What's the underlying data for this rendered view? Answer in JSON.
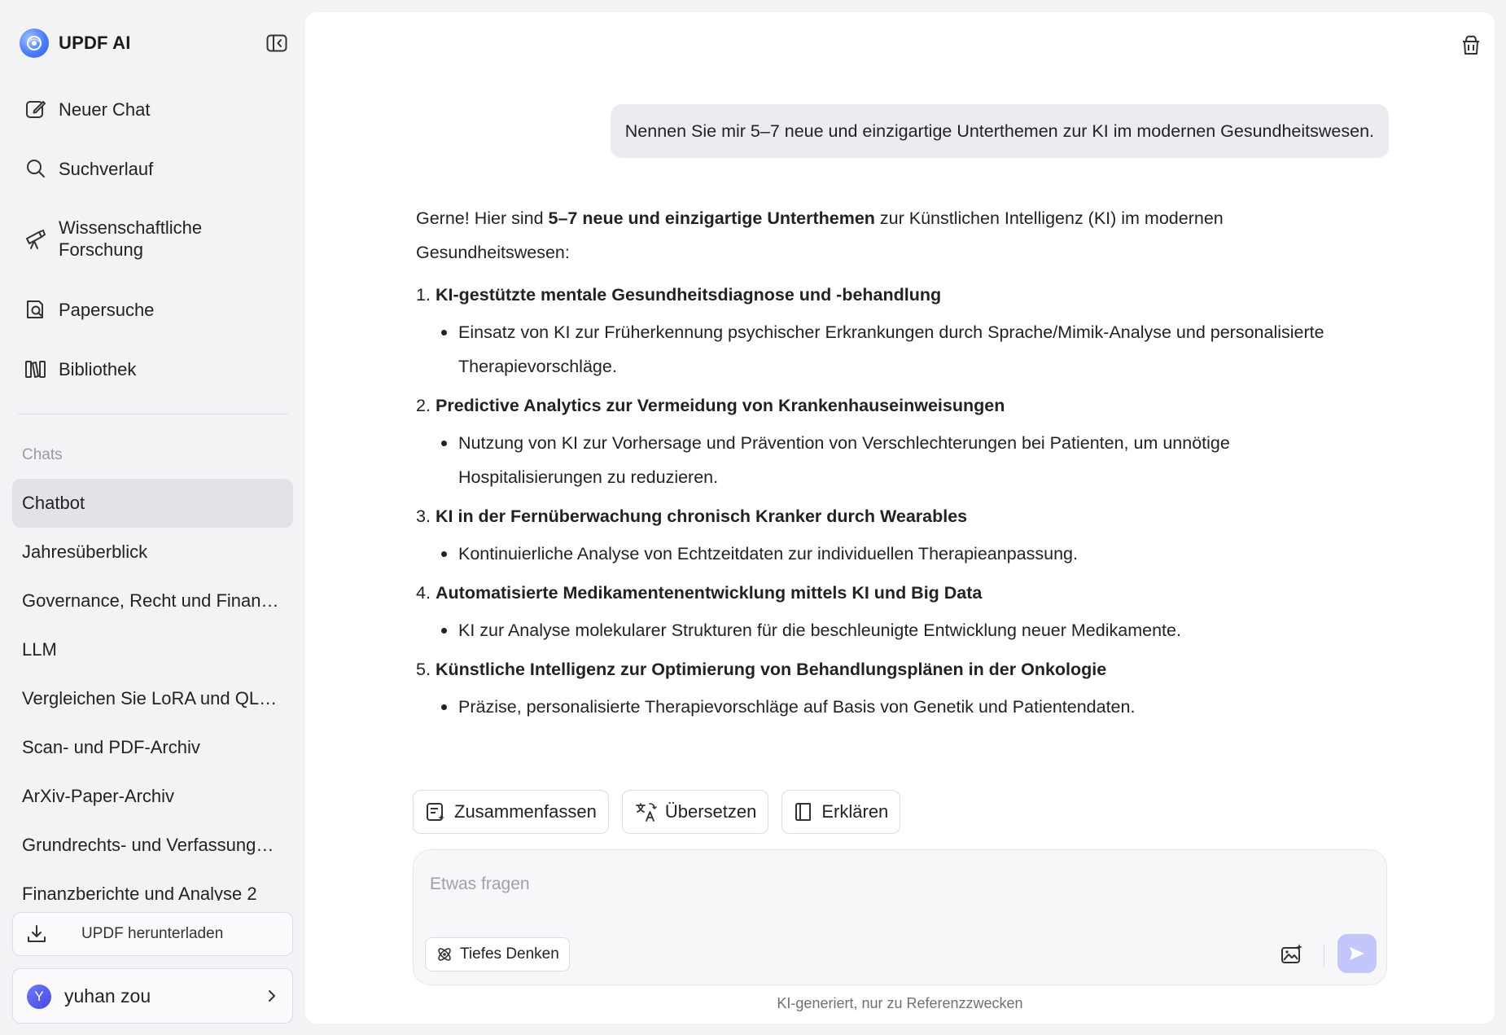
{
  "brand": {
    "name": "UPDF AI"
  },
  "nav": [
    {
      "label": "Neuer Chat",
      "icon": "edit-icon"
    },
    {
      "label": "Suchverlauf",
      "icon": "search-icon"
    },
    {
      "label": "Wissenschaftliche Forschung",
      "icon": "telescope-icon"
    },
    {
      "label": "Papersuche",
      "icon": "document-search-icon"
    },
    {
      "label": "Bibliothek",
      "icon": "library-icon"
    }
  ],
  "chats": {
    "heading": "Chats",
    "items": [
      "Chatbot",
      "Jahresüberblick",
      "Governance, Recht und Finanzen",
      "LLM",
      "Vergleichen Sie LoRA und QLoRA",
      "Scan- und PDF-Archiv",
      "ArXiv-Paper-Archiv",
      "Grundrechts- und Verfassungsrecht",
      "Finanzberichte und Analyse 2"
    ],
    "active_index": 0
  },
  "download": {
    "label": "UPDF herunterladen"
  },
  "user": {
    "initial": "Y",
    "name": "yuhan zou"
  },
  "conversation": {
    "user_message": "Nennen Sie mir 5–7 neue und einzigartige Unterthemen zur KI im modernen Gesundheitswesen.",
    "intro_before": "Gerne! Hier sind ",
    "intro_bold": "5–7 neue und einzigartige Unterthemen",
    "intro_after": " zur Künstlichen Intelligenz (KI) im modernen Gesundheitswesen:",
    "topics": [
      {
        "num": "1.",
        "title": "KI-gestützte mentale Gesundheitsdiagnose und -behandlung",
        "bullet": "Einsatz von KI zur Früherkennung psychischer Erkrankungen durch Sprache/Mimik-Analyse und personalisierte Therapievorschläge."
      },
      {
        "num": "2.",
        "title": "Predictive Analytics zur Vermeidung von Krankenhauseinweisungen",
        "bullet": "Nutzung von KI zur Vorhersage und Prävention von Verschlechterungen bei Patienten, um unnötige Hospitalisierungen zu reduzieren."
      },
      {
        "num": "3.",
        "title": "KI in der Fernüberwachung chronisch Kranker durch Wearables",
        "bullet": "Kontinuierliche Analyse von Echtzeitdaten zur individuellen Therapieanpassung."
      },
      {
        "num": "4.",
        "title": "Automatisierte Medikamentenentwicklung mittels KI und Big Data",
        "bullet": "KI zur Analyse molekularer Strukturen für die beschleunigte Entwicklung neuer Medikamente."
      },
      {
        "num": "5.",
        "title": "Künstliche Intelligenz zur Optimierung von Behandlungsplänen in der Onkologie",
        "bullet": "Präzise, personalisierte Therapievorschläge auf Basis von Genetik und Patientendaten."
      }
    ]
  },
  "actions": {
    "summarize": "Zusammenfassen",
    "translate": "Übersetzen",
    "explain": "Erklären"
  },
  "input": {
    "placeholder": "Etwas fragen",
    "value": "",
    "deep_thinking": "Tiefes Denken"
  },
  "disclaimer": "KI-generiert, nur zu Referenzzwecken",
  "colors": {
    "accent": "#4a7bff",
    "send_disabled": "#c3c6fb",
    "active_chat_bg": "#e2e2e8"
  }
}
